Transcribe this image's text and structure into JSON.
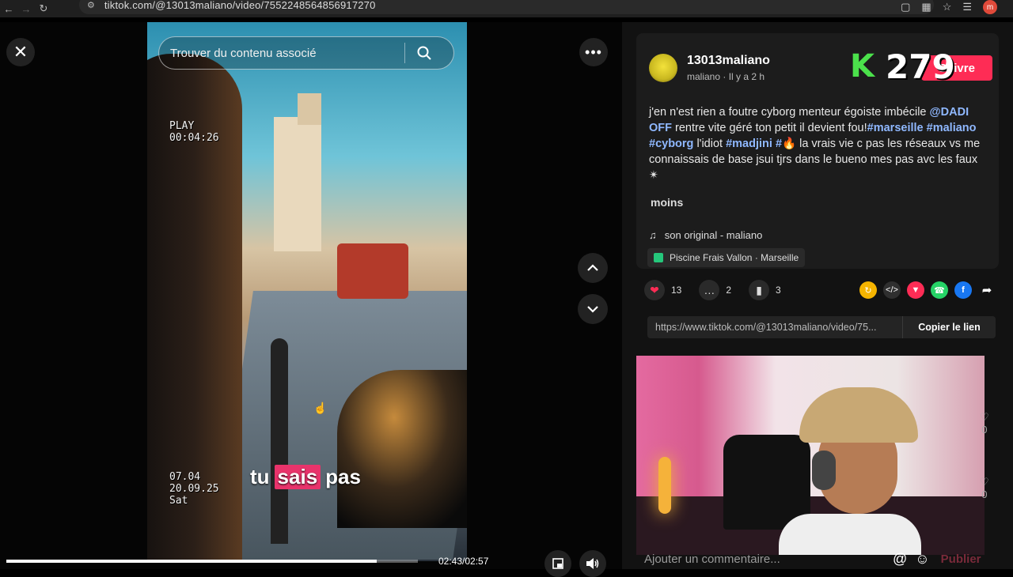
{
  "browser": {
    "url": "tiktok.com/@13013maliano/video/7552248564856917270",
    "profile_initial": "m"
  },
  "player": {
    "search_placeholder": "Trouver du contenu associé",
    "osd_top_line1": "PLAY",
    "osd_top_line2": "00:04:26",
    "osd_bottom_line1": "07.04",
    "osd_bottom_line2": "20.09.25",
    "osd_bottom_line3": "Sat",
    "subtitle_word1": "tu",
    "subtitle_word2": "sais",
    "subtitle_word3": "pas",
    "current_time": "02:43",
    "total_time": "02:57",
    "time_readout": "02:43/02:57",
    "progress_fraction": 0.9
  },
  "post": {
    "username": "13013maliano",
    "nickname": "maliano",
    "posted": "Il y a 2 h",
    "sub_meta": "maliano · Il y a 2 h",
    "follow_label": "Suivre",
    "desc_part1": "j'en n'est rien a foutre cyborg menteur égoiste imbécile ",
    "mention": "@DADI OFF",
    "desc_part2": " rentre vite géré ton petit il devient fou!",
    "tag_marseille": "#marseille",
    "tag_maliano": "#maliano",
    "tag_cyborg": "#cyborg",
    "desc_part3": " l'idiot ",
    "tag_madjini": "#madjini",
    "tag_hash": "#",
    "desc_part4": "🔥 la vrais vie c pas les réseaux vs me connaissais de base jsui tjrs dans le bueno mes pas avc les faux ✴",
    "less_label": "moins",
    "music": "son original - maliano",
    "location": "Piscine Frais Vallon · Marseille"
  },
  "overlay_counter": {
    "logo": "K",
    "value": "279"
  },
  "actions": {
    "likes": "13",
    "comments": "2",
    "saves": "3"
  },
  "share": {
    "link": "https://www.tiktok.com/@13013maliano/video/75...",
    "copy_label": "Copier le lien"
  },
  "comment": {
    "placeholder": "Ajouter un commentaire...",
    "publish_label": "Publier",
    "side_count_1": "0",
    "side_count_2": "0"
  },
  "colors": {
    "accent": "#fe2c55",
    "hashtag": "#8fb8ff",
    "counter_logo": "#4be14b"
  }
}
